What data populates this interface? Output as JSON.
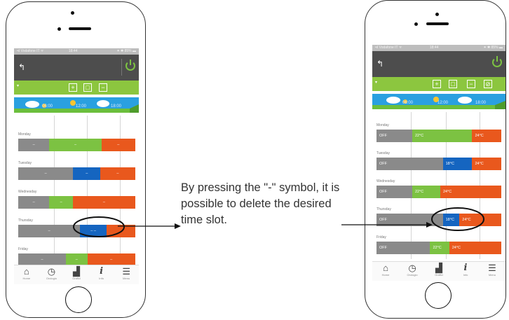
{
  "status": {
    "left": "•ıl Vodafone IT  ᯤ",
    "time": "18:44",
    "right": "⁕ ✱ 85% ▬"
  },
  "left_phone": {
    "toolbar_buttons": [
      "+",
      "□",
      "−"
    ],
    "times": [
      "06:00",
      "12:00",
      "18:00"
    ],
    "days": [
      {
        "name": "Monday",
        "segments": [
          {
            "c": "g",
            "w": 26,
            "t": "–"
          },
          {
            "c": "gr",
            "w": 44,
            "t": "–"
          },
          {
            "c": "o",
            "w": 28,
            "t": "–"
          }
        ]
      },
      {
        "name": "Tuesday",
        "segments": [
          {
            "c": "g",
            "w": 46,
            "t": "–"
          },
          {
            "c": "b",
            "w": 23,
            "t": "–"
          },
          {
            "c": "o",
            "w": 29,
            "t": "–"
          }
        ]
      },
      {
        "name": "Wednesday",
        "segments": [
          {
            "c": "g",
            "w": 26,
            "t": "–"
          },
          {
            "c": "gr",
            "w": 20,
            "t": "–"
          },
          {
            "c": "o",
            "w": 52,
            "t": "–"
          }
        ]
      },
      {
        "name": "Thursday",
        "segments": [
          {
            "c": "g",
            "w": 52,
            "t": "–"
          },
          {
            "c": "b",
            "w": 22,
            "t": "–  –"
          },
          {
            "c": "o",
            "w": 24,
            "t": ""
          }
        ]
      },
      {
        "name": "Friday",
        "segments": [
          {
            "c": "g",
            "w": 40,
            "t": "–"
          },
          {
            "c": "gr",
            "w": 18,
            "t": "–"
          },
          {
            "c": "o",
            "w": 40,
            "t": "–"
          }
        ]
      }
    ]
  },
  "right_phone": {
    "toolbar_buttons": [
      "+",
      "□",
      "−",
      "⊘"
    ],
    "times": [
      "06:00",
      "12:00",
      "18:00"
    ],
    "days": [
      {
        "name": "Monday",
        "segments": [
          {
            "c": "g",
            "w": 28,
            "t": "OFF"
          },
          {
            "c": "gr",
            "w": 47,
            "t": "22°C"
          },
          {
            "c": "o",
            "w": 23,
            "t": "24°C"
          }
        ]
      },
      {
        "name": "Tuesday",
        "segments": [
          {
            "c": "g",
            "w": 52,
            "t": "OFF"
          },
          {
            "c": "b",
            "w": 23,
            "t": "18°C"
          },
          {
            "c": "o",
            "w": 23,
            "t": "24°C"
          }
        ]
      },
      {
        "name": "Wednesday",
        "segments": [
          {
            "c": "g",
            "w": 28,
            "t": "OFF"
          },
          {
            "c": "gr",
            "w": 22,
            "t": "22°C"
          },
          {
            "c": "o",
            "w": 48,
            "t": "24°C"
          }
        ]
      },
      {
        "name": "Thursday",
        "segments": [
          {
            "c": "g",
            "w": 52,
            "t": "OFF"
          },
          {
            "c": "b",
            "w": 13,
            "t": "18°C"
          },
          {
            "c": "o",
            "w": 33,
            "t": "24°C"
          }
        ]
      },
      {
        "name": "Friday",
        "segments": [
          {
            "c": "g",
            "w": 42,
            "t": "OFF"
          },
          {
            "c": "gr",
            "w": 15,
            "t": "22°C"
          },
          {
            "c": "o",
            "w": 41,
            "t": "24°C"
          }
        ]
      }
    ]
  },
  "nav": [
    {
      "glyph": "⌂",
      "label": "Home",
      "icon": "home-icon"
    },
    {
      "glyph": "◷",
      "label": "Orologio",
      "icon": "clock-icon"
    },
    {
      "glyph": "▟",
      "label": "Grafici",
      "icon": "graphs-icon"
    },
    {
      "glyph": "i",
      "label": "Info",
      "icon": "info-icon"
    },
    {
      "glyph": "☰",
      "label": "Menu",
      "icon": "menu-icon"
    }
  ],
  "caption": "By pressing the \"-\" symbol, it is possible to delete the desired time slot."
}
